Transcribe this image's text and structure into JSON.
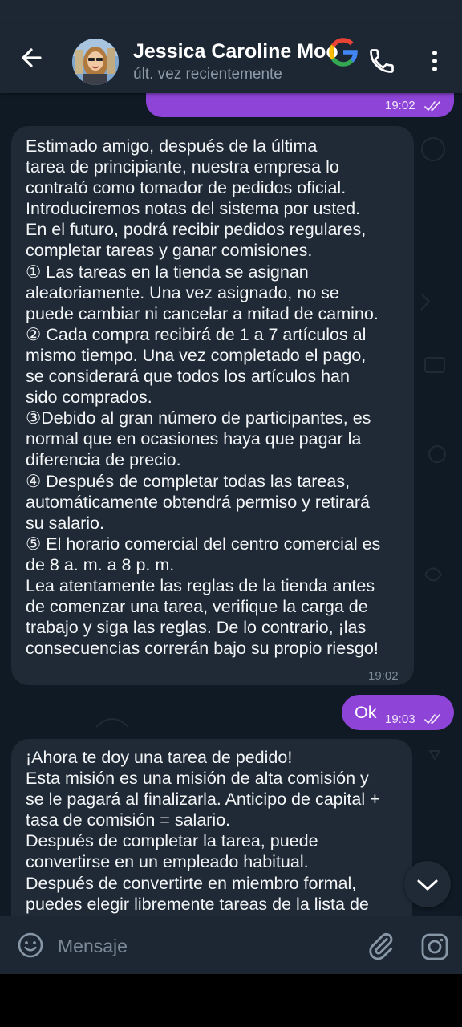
{
  "header": {
    "title": "Jessica Caroline Moo",
    "subtitle": "últ. vez recientemente"
  },
  "messages": [
    {
      "dir": "out",
      "time": "19:02",
      "text": ""
    },
    {
      "dir": "in",
      "time": "19:02",
      "text": "Estimado amigo, después de la última\ntarea de principiante, nuestra empresa lo\ncontrató como tomador de pedidos oficial.\nIntroduciremos notas del sistema por usted.\nEn el futuro, podrá recibir pedidos regulares,\ncompletar tareas y ganar comisiones.\n① Las tareas en la tienda se asignan\naleatoriamente. Una vez asignado, no se\npuede cambiar ni cancelar a mitad de camino.\n② Cada compra recibirá de 1 a 7 artículos al\nmismo tiempo. Una vez completado el pago,\nse considerará que todos los artículos han\nsido comprados.\n③Debido al gran número de participantes, es\nnormal que en ocasiones haya que pagar la\ndiferencia de precio.\n④ Después de completar todas las tareas,\nautomáticamente obtendrá permiso y retirará\nsu salario.\n⑤ El horario comercial del centro comercial es\nde 8 a. m. a 8 p. m.\nLea atentamente las reglas de la tienda antes\nde comenzar una tarea, verifique la carga de\ntrabajo y siga las reglas. De lo contrario, ¡las\nconsecuencias correrán bajo su propio riesgo!"
    },
    {
      "dir": "out",
      "time": "19:03",
      "text": "Ok"
    },
    {
      "dir": "in",
      "time": "",
      "text": "¡Ahora te doy una tarea de pedido!\nEsta misión es una misión de alta comisión y\nse le pagará al finalizarla. Anticipo de capital +\ntasa de comisión = salario.\nDespués de completar la tarea, puede\nconvertirse en un empleado habitual.\nDespués de convertirte en miembro formal,\npuedes elegir libremente tareas de la lista de"
    }
  ],
  "composer": {
    "placeholder": "Mensaje"
  },
  "icons": {
    "back": "arrow-left-icon",
    "google": "google-g-icon",
    "call": "phone-icon",
    "menu": "more-vertical-icon",
    "emoji": "smiley-icon",
    "attach": "paperclip-icon",
    "camera": "instagram-camera-icon",
    "scroll": "chevron-down-icon",
    "read": "double-check-icon"
  },
  "colors": {
    "header_bg": "#1d2733",
    "chat_bg": "#0f1a24",
    "outgoing_bubble": "#8e44d6",
    "incoming_bubble": "#1f2a36",
    "google_blue": "#4285F4",
    "google_red": "#EA4335",
    "google_yellow": "#FBBC05",
    "google_green": "#34A853"
  }
}
